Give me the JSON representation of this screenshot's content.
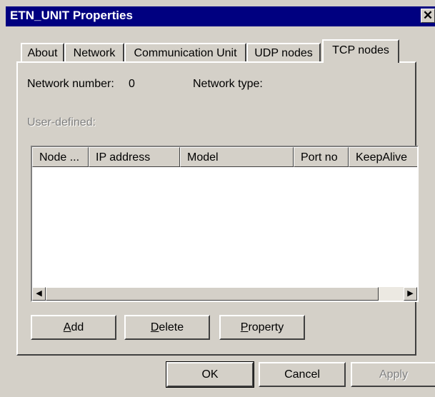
{
  "window": {
    "title": "ETN_UNIT Properties",
    "close_glyph": "✕"
  },
  "tabs": [
    {
      "label": "About"
    },
    {
      "label": "Network"
    },
    {
      "label": "Communication Unit"
    },
    {
      "label": "UDP nodes"
    },
    {
      "label": "TCP nodes",
      "active": true
    }
  ],
  "panel": {
    "network_number_label": "Network number:",
    "network_number_value": "0",
    "network_type_label": "Network type:",
    "network_type_value": "",
    "user_defined_label": "User-defined:"
  },
  "list": {
    "columns": [
      "Node ...",
      "IP address",
      "Model",
      "Port no",
      "KeepAlive"
    ],
    "rows": [],
    "scroll_left_icon": "◀",
    "scroll_right_icon": "▶"
  },
  "panel_buttons": {
    "add": {
      "mnemonic": "A",
      "rest": "dd"
    },
    "delete": {
      "mnemonic": "D",
      "rest": "elete"
    },
    "property": {
      "mnemonic": "P",
      "rest": "roperty"
    }
  },
  "footer_buttons": {
    "ok": "OK",
    "cancel": "Cancel",
    "apply": "Apply"
  },
  "colors": {
    "face": "#d4d0c8",
    "titlebar": "#000080",
    "disabled_text": "#808080"
  }
}
